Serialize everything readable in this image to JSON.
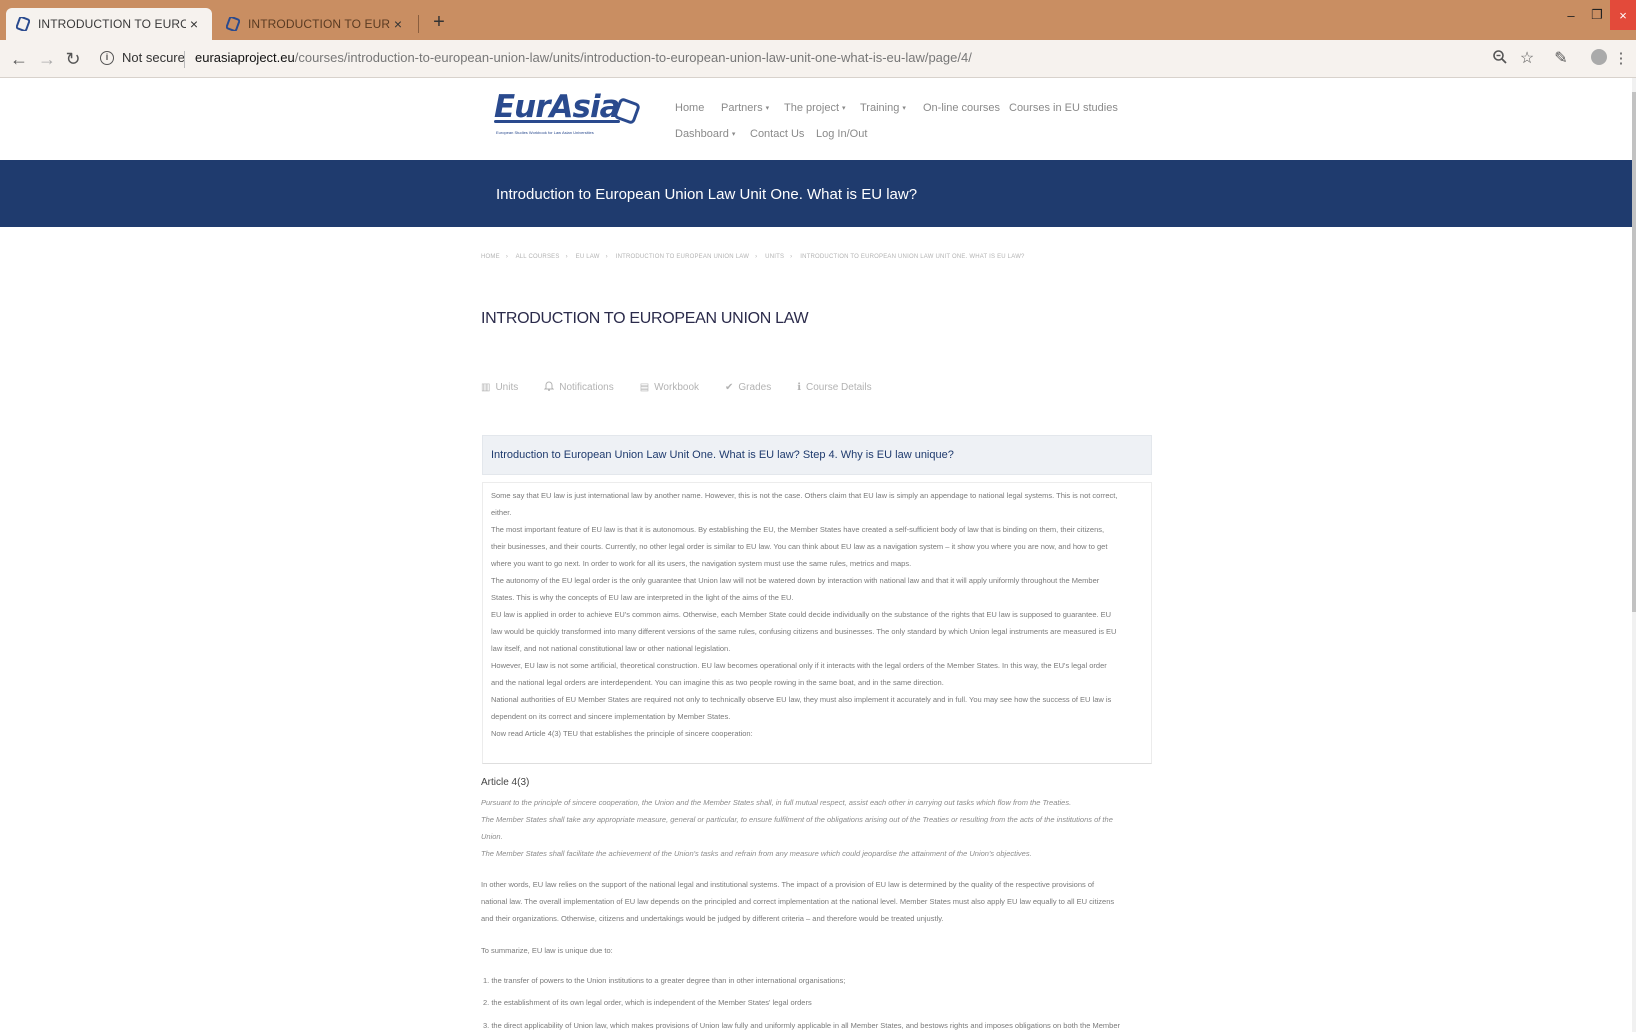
{
  "browser": {
    "tabs": [
      {
        "title": "INTRODUCTION TO EUROPEAN",
        "active": true
      },
      {
        "title": "INTRODUCTION TO EUROPEAN",
        "active": false
      }
    ],
    "tab_close_glyph": "×",
    "new_tab_glyph": "+",
    "window_controls": {
      "minimize": "–",
      "maximize": "❐",
      "close": "×"
    },
    "security_label": "Not secure",
    "url_host": "eurasiaproject.eu",
    "url_path": "/courses/introduction-to-european-union-law/units/introduction-to-european-union-law-unit-one-what-is-eu-law/page/4/",
    "icons": [
      "back-icon",
      "forward-icon",
      "reload-icon",
      "info-icon",
      "zoom-icon",
      "star-icon",
      "extension-icon",
      "account-icon",
      "menu-icon"
    ]
  },
  "site": {
    "logo_text": "EurAsia",
    "logo_subtitle": "European Studies Workbook for Law Asian Universities",
    "nav": [
      {
        "label": "Home",
        "has_dropdown": false
      },
      {
        "label": "Partners",
        "has_dropdown": true
      },
      {
        "label": "The project",
        "has_dropdown": true
      },
      {
        "label": "Training",
        "has_dropdown": true
      },
      {
        "label": "On-line courses",
        "has_dropdown": false
      },
      {
        "label": "Courses in EU studies",
        "has_dropdown": false
      },
      {
        "label": "Dashboard",
        "has_dropdown": true
      },
      {
        "label": "Contact Us",
        "has_dropdown": false
      },
      {
        "label": "Log In/Out",
        "has_dropdown": false
      }
    ],
    "dropdown_caret": "▾"
  },
  "banner": {
    "title": "Introduction to European Union Law Unit One. What is EU law?"
  },
  "breadcrumb": [
    "HOME",
    "ALL COURSES",
    "EU LAW",
    "INTRODUCTION TO EUROPEAN UNION LAW",
    "UNITS",
    "INTRODUCTION TO EUROPEAN UNION LAW UNIT ONE. WHAT IS EU LAW?"
  ],
  "breadcrumb_sep": "›",
  "course": {
    "title": "INTRODUCTION TO EUROPEAN UNION LAW",
    "tabs": [
      {
        "label": "Units",
        "icon": "chart-icon",
        "glyph": "▥"
      },
      {
        "label": "Notifications",
        "icon": "bell-icon",
        "glyph": "🔔"
      },
      {
        "label": "Workbook",
        "icon": "book-icon",
        "glyph": "▤"
      },
      {
        "label": "Grades",
        "icon": "check-circle-icon",
        "glyph": "✔"
      },
      {
        "label": "Course Details",
        "icon": "info-circle-icon",
        "glyph": "ℹ"
      }
    ]
  },
  "step": {
    "title": "Introduction to European Union Law Unit One. What is EU law? Step 4. Why is EU law unique?",
    "lines": [
      "Some say that EU law is just international law by another name. However, this is not the case. Others claim that EU law is simply an appendage to national legal systems. This is not correct,",
      "either.",
      "The most important feature of EU law is that it is autonomous. By establishing the EU, the Member States have created a self-sufficient body of law that is binding on them, their citizens,",
      "their businesses, and their courts. Currently, no other legal order is similar to EU law. You can think about EU law as a navigation system – it show you where you are now, and how to get",
      "where you want to go next. In order to work for all its users, the navigation system must use the same rules, metrics and maps.",
      "The autonomy of the EU legal order is the only guarantee that Union law will not be watered down by interaction with national law and that it will apply uniformly throughout the Member",
      "States. This is why the concepts of EU law are interpreted in the light of the aims of the EU.",
      "EU law is applied in order to achieve EU's common aims. Otherwise, each Member State could decide individually on the substance of the rights that EU law is supposed to guarantee. EU",
      "law would be quickly transformed into many different versions of the same rules, confusing citizens and businesses. The only standard by which Union legal instruments are measured is EU",
      "law itself, and not national constitutional law or other national legislation.",
      "However, EU law is not some artificial, theoretical construction. EU law becomes operational only if it interacts with the legal orders of the Member States. In this way, the EU's legal order",
      "and the national legal orders are interdependent. You can imagine this as two people rowing in the same boat, and in the same direction.",
      "National authorities of EU Member States are required not only to technically observe EU law, they must also implement it accurately and in full. You may see how the success of EU law is",
      "dependent on its correct and sincere implementation by Member States.",
      "Now read Article 4(3) TEU that establishes the principle of sincere cooperation:"
    ]
  },
  "article": {
    "heading": "Article 4(3)",
    "lines": [
      "Pursuant to the principle of sincere cooperation, the Union and the Member States shall, in full mutual respect, assist each other in carrying out tasks which flow from the Treaties.",
      "The Member States shall take any appropriate measure, general or particular, to ensure fulfilment of the obligations arising out of the Treaties or resulting from the acts of the institutions of the",
      "Union.",
      "The Member States shall facilitate the achievement of the Union's tasks and refrain from any measure which could jeopardise the attainment of the Union's objectives."
    ]
  },
  "body": {
    "lines": [
      "In other words, EU law relies on the support of the national legal and institutional systems. The impact of a provision of EU law is determined by the quality of the respective provisions of",
      "national law. The overall implementation of EU law depends on the principled and correct implementation at the national level. Member States must also apply EU law equally to all EU citizens",
      "and their organizations. Otherwise, citizens and undertakings would be judged by different criteria – and therefore would be treated unjustly."
    ],
    "summary_intro": "To summarize, EU law is unique due to:",
    "list": [
      "1. the transfer of powers to the Union institutions to a greater degree than in other international organisations;",
      "2. the establishment of its own legal order, which is independent of the Member States' legal orders",
      "3. the direct applicability of Union law, which makes provisions of Union law fully and uniformly applicable in all Member States, and bestows rights and imposes obligations on both the Member"
    ]
  },
  "colors": {
    "tabstrip": "#c98e62",
    "banner": "#1f3b6e",
    "brand": "#2a4a8e",
    "close_button": "#e34a3a"
  }
}
